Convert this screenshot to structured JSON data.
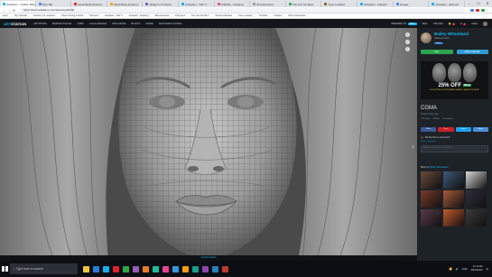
{
  "browser": {
    "tabs": [
      {
        "label": "Artstation - CGMA, Bailey Wheat...",
        "active": true,
        "color": "#13aff0"
      },
      {
        "label": "New Tab",
        "active": false,
        "color": "#4285f4"
      },
      {
        "label": "Head-Skull Anatomy",
        "active": false,
        "color": "#e0232b"
      },
      {
        "label": "Hand-Body Anatomy",
        "active": false,
        "color": "#f2a900"
      },
      {
        "label": "Weapon of Choice",
        "active": false,
        "color": "#6a5acd"
      },
      {
        "label": "Artstation - Will Yi...",
        "active": false,
        "color": "#13aff0"
      },
      {
        "label": "Dribbble - Drawing",
        "active": false,
        "color": "#ea4c89"
      },
      {
        "label": "Zbrushcentral",
        "active": false,
        "color": "#999999"
      },
      {
        "label": "The Top Ten Best",
        "active": false,
        "color": "#2da44e"
      },
      {
        "label": "Face Lookdev",
        "active": false,
        "color": "#8b5a2b"
      },
      {
        "label": "Artstation - Rakesh",
        "active": false,
        "color": "#13aff0"
      },
      {
        "label": "Google",
        "active": false,
        "color": "#4285f4"
      },
      {
        "label": "Artstation - Elite Art",
        "active": false,
        "color": "#13aff0"
      }
    ],
    "url": "https://www.artstation.com/artwork/yGK5E",
    "bookmarks": [
      "Apps",
      "Top Tutorials",
      "Anatomy for sculptors",
      "Head Cloning Tutorial",
      "Pinterest",
      "Artstation - Will Yi",
      "Artstation - Drawing",
      "ZBrushcentral",
      "Polycount",
      "The Top Ten Best",
      "Scanned Models",
      "Face Lookdev",
      "Tutorials",
      "Youtube",
      "Other bookmarks"
    ],
    "window_controls": [
      "–",
      "☐",
      "✕"
    ]
  },
  "site": {
    "logo_prefix": "ART",
    "logo_suffix": "STATION",
    "nav": [
      "ARTWORK",
      "MARKETPLACE",
      "JOBS",
      "CHALLENGES",
      "MAGAZINE",
      "BLOGS",
      "MORE",
      "MASTERCLASSES"
    ],
    "upgrade": "UPGRADE TO",
    "pro": "PRO",
    "sell": "SELL",
    "upload": "UPLOAD",
    "notifications_count": "3",
    "messages_count": "1",
    "username": "Adam"
  },
  "viewer": {
    "tools": [
      "+",
      "⤢",
      "⋮"
    ],
    "next_arrow": "›",
    "caption": "Artwork details"
  },
  "sidebar": {
    "artist_name": "Bailey Wheatland",
    "artist_title": "Character Artist",
    "follow_label": "Follow",
    "like_label": "Like",
    "add_to_collection_label": "Add to collection",
    "ad": {
      "headline": "25% OFF",
      "tag": "SALE",
      "line": "SCULPTING & TEXTURING HEADS | SAVE 25% NOW!"
    },
    "artwork_title": "CGMA",
    "posted": "Posted 3 days ago",
    "stats": [
      "2,124 likes",
      "22 likes",
      "6 comments"
    ],
    "share": [
      "Share",
      "Pin it",
      "Tweet",
      "Share"
    ],
    "comment_prompt": "Be the first to comment!",
    "comment_link": "Write a comment",
    "comment_placeholder": "Add your feedback, ask questions...",
    "more_by_label": "More by",
    "more_by_name": "Bailey Wheatland",
    "thumb_colors": [
      "#6b4a3a",
      "#3d5a7a",
      "#d8d8d8",
      "#7a3b2a",
      "#a65a3a",
      "#2e2e3a",
      "#5a3a4a",
      "#c45a2a",
      "#3a3a3a"
    ]
  },
  "taskbar": {
    "search_placeholder": "Type here to search",
    "apps": [
      "#f4c542",
      "#2b7bd8",
      "#13aff0",
      "#e0232b",
      "#2da44e",
      "#9b59b6",
      "#e67e22",
      "#1abc9c",
      "#e84393",
      "#3498db",
      "#f39c12",
      "#16a085",
      "#8e44ad",
      "#2980b9",
      "#c0392b"
    ],
    "tray_status": "ENG",
    "time": "11:14 AM",
    "date": "08/11/2019"
  }
}
